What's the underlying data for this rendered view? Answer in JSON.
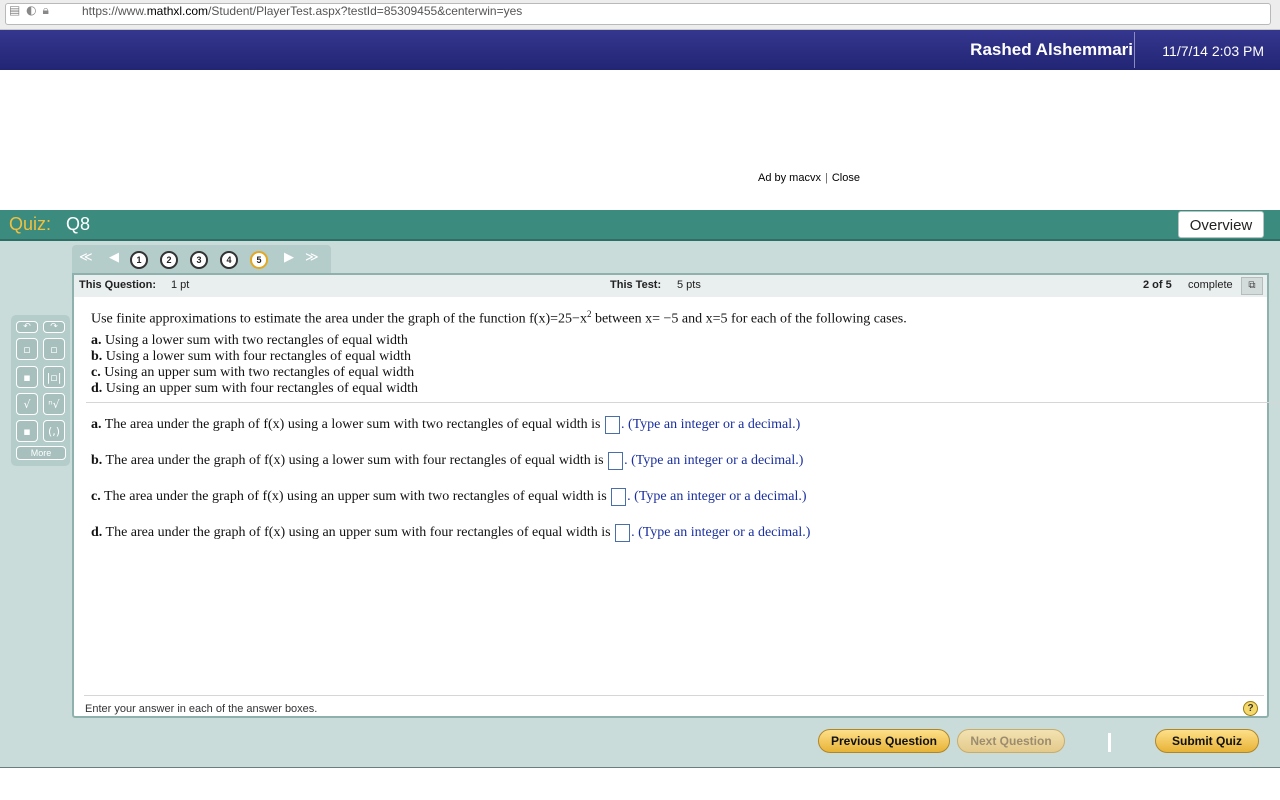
{
  "browser": {
    "url_prefix": "https://www.",
    "url_domain": "mathxl.com",
    "url_path": "/Student/PlayerTest.aspx?testId=85309455&centerwin=yes"
  },
  "header": {
    "user_name": "Rashed Alshemmari",
    "datetime": "11/7/14 2:03 PM"
  },
  "ad": {
    "text": "Ad by macvx",
    "separator": "|",
    "close": "Close"
  },
  "quiz": {
    "label": "Quiz:",
    "name": "Q8",
    "overview": "Overview"
  },
  "nav": {
    "questions": [
      "1",
      "2",
      "3",
      "4",
      "5"
    ],
    "current_index": 4
  },
  "status": {
    "this_question_label": "This Question:",
    "this_question_value": "1 pt",
    "this_test_label": "This Test:",
    "this_test_value": "5 pts",
    "progress_count": "2 of 5",
    "progress_label": "complete"
  },
  "question": {
    "intro_a": "Use finite approximations to estimate the area under the graph of the function f(x)",
    "intro_b": "=",
    "intro_c": "25",
    "intro_d": "−",
    "intro_e": "x",
    "intro_sup": "2",
    "intro_f": " between x",
    "intro_g": "=",
    "intro_h": "−",
    "intro_i": "5 and x",
    "intro_j": "=",
    "intro_k": "5 for each of the following cases.",
    "cases": [
      {
        "letter": "a.",
        "text": " Using a lower sum with two rectangles of equal width"
      },
      {
        "letter": "b.",
        "text": " Using a lower sum with four rectangles of equal width"
      },
      {
        "letter": "c.",
        "text": " Using an upper sum with two rectangles of equal width"
      },
      {
        "letter": "d.",
        "text": " Using an upper sum with four rectangles of equal width"
      }
    ],
    "answers": [
      {
        "letter": "a.",
        "text": " The area under the graph of f(x) using a lower sum with two rectangles of equal width is ",
        "hint": ". (Type an integer or a decimal.)"
      },
      {
        "letter": "b.",
        "text": " The area under the graph of f(x) using a lower sum with four rectangles of equal width is ",
        "hint": ". (Type an integer or a decimal.)"
      },
      {
        "letter": "c.",
        "text": " The area under the graph of f(x) using an upper sum with two rectangles of equal width is ",
        "hint": ". (Type an integer or a decimal.)"
      },
      {
        "letter": "d.",
        "text": " The area under the graph of f(x) using an upper sum with four rectangles of equal width is ",
        "hint": ". (Type an integer or a decimal.)"
      }
    ],
    "instruction": "Enter your answer in each of the answer boxes.",
    "help": "?"
  },
  "palette": {
    "more": "More"
  },
  "footer": {
    "previous": "Previous Question",
    "next": "Next Question",
    "submit": "Submit Quiz"
  }
}
